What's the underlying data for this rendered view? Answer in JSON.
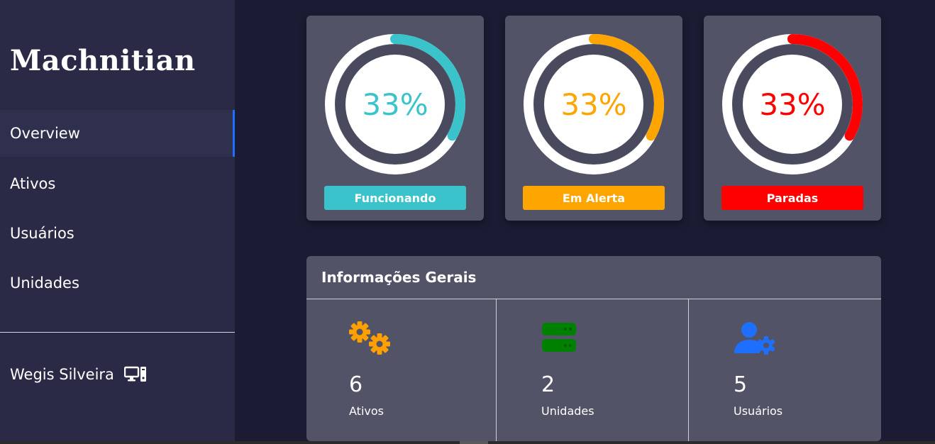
{
  "brand": "Machnitian",
  "nav": {
    "items": [
      {
        "label": "Overview"
      },
      {
        "label": "Ativos"
      },
      {
        "label": "Usuários"
      },
      {
        "label": "Unidades"
      }
    ]
  },
  "user": {
    "name": "Wegis Silveira",
    "icon": "computer-icon"
  },
  "status_cards": [
    {
      "percent_label": "33%",
      "percent": 33,
      "status": "Funcionando",
      "color": "#3bc3cc"
    },
    {
      "percent_label": "33%",
      "percent": 33,
      "status": "Em Alerta",
      "color": "#ffa500"
    },
    {
      "percent_label": "33%",
      "percent": 33,
      "status": "Paradas",
      "color": "#ff0000"
    }
  ],
  "info": {
    "title": "Informações Gerais",
    "stats": [
      {
        "value": "6",
        "label": "Ativos",
        "icon": "gears-icon",
        "color": "#ff9f00"
      },
      {
        "value": "2",
        "label": "Unidades",
        "icon": "server-icon",
        "color": "#008000"
      },
      {
        "value": "5",
        "label": "Usuários",
        "icon": "user-gear-icon",
        "color": "#1f6fff"
      }
    ]
  }
}
